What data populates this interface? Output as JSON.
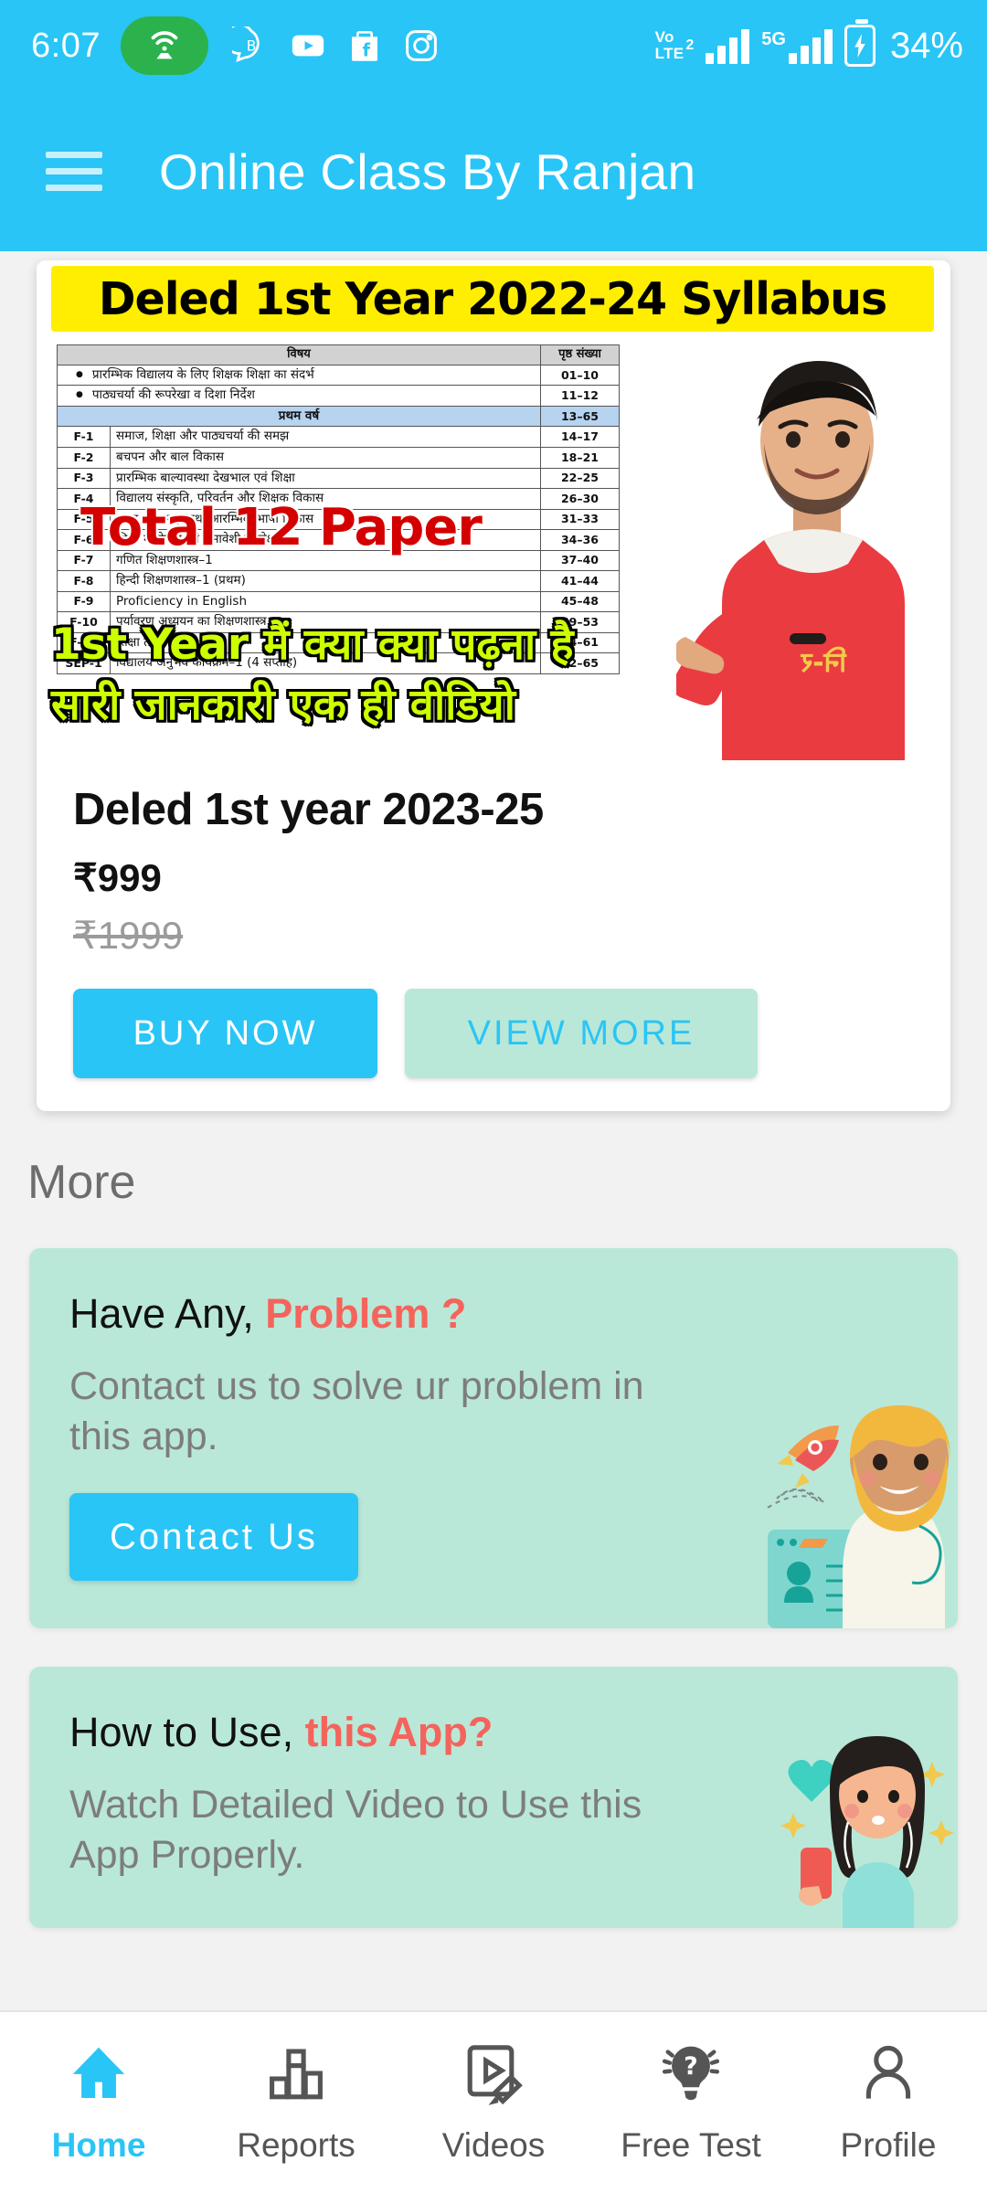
{
  "statusbar": {
    "time": "6:07",
    "hotspot_icon": "hotspot-icon",
    "notif_icons": [
      "bluestacks-icon",
      "youtube-icon",
      "flipkart-icon",
      "instagram-icon"
    ],
    "volte_label_top": "Vo",
    "volte_label_bottom": "LTE",
    "sim_badge": "2",
    "network_label": "5G",
    "battery_percent": "34%"
  },
  "appbar": {
    "menu_icon": "hamburger-menu-icon",
    "title": "Online Class By Ranjan"
  },
  "course": {
    "thumbnail": {
      "banner_text": "Deled 1st Year 2022-24 Syllabus",
      "overlay_red": "Total 12 Paper",
      "overlay_hindi_line1": "1st Year मैं क्या क्या पढ़ना है",
      "overlay_hindi_line2": "सारी जानकारी एक ही वीडियो",
      "syllabus_table": {
        "headers": [
          "विषय",
          "पृष्ठ संख्या"
        ],
        "rows": [
          {
            "code": "",
            "subject": "प्रारम्भिक विद्यालय के लिए शिक्षक शिक्षा का संदर्भ",
            "pages": "01–10",
            "bullet": true
          },
          {
            "code": "",
            "subject": "पाठ्यचर्या की रूपरेखा व दिशा निर्देश",
            "pages": "11–12",
            "bullet": true
          },
          {
            "code": "",
            "subject": "प्रथम वर्ष",
            "pages": "13–65",
            "highlight": true
          },
          {
            "code": "F-1",
            "subject": "समाज, शिक्षा और पाठ्यचर्या की समझ",
            "pages": "14–17"
          },
          {
            "code": "F-2",
            "subject": "बचपन और बाल विकास",
            "pages": "18–21"
          },
          {
            "code": "F-3",
            "subject": "प्रारम्भिक बाल्यावस्था देखभाल एवं शिक्षा",
            "pages": "22–25"
          },
          {
            "code": "F-4",
            "subject": "विद्यालय संस्कृति, परिवर्तन और शिक्षक विकास",
            "pages": "26–30"
          },
          {
            "code": "F-5",
            "subject": "भाषा की समझ तथा आरम्भिक भाषा विकास",
            "pages": "31–33"
          },
          {
            "code": "F-6",
            "subject": "शिक्षा में जेण्डर एवं समावेशी परिप्रेक्ष्य",
            "pages": "34–36"
          },
          {
            "code": "F-7",
            "subject": "गणित शिक्षणशास्त्र–1",
            "pages": "37–40"
          },
          {
            "code": "F-8",
            "subject": "हिन्दी शिक्षणशास्त्र–1 (प्रथम)",
            "pages": "41–44"
          },
          {
            "code": "F-9",
            "subject": "Proficiency in English",
            "pages": "45–48"
          },
          {
            "code": "F-10",
            "subject": "पर्यावरण अध्ययन का शिक्षणशास्त्र",
            "pages": "49–53"
          },
          {
            "code": "F-11",
            "subject": "शिक्षा तकनीकी",
            "pages": "54–61"
          },
          {
            "code": "SEP-1",
            "subject": "विद्यालय अनुभव कार्यक्रम–1 (4 सप्ताह)",
            "pages": "62–65"
          }
        ]
      }
    },
    "title": "Deled 1st year 2023-25",
    "price": "₹999",
    "price_original": "₹1999",
    "buy_label": "BUY NOW",
    "view_label": "VIEW MORE"
  },
  "more": {
    "heading": "More",
    "cards": [
      {
        "title_plain": "Have Any, ",
        "title_accent": "Problem ?",
        "subtitle": "Contact us to solve ur problem in this app.",
        "button_label": "Contact Us",
        "art": "support-agent-illustration"
      },
      {
        "title_plain": "How to Use, ",
        "title_accent": "this App?",
        "subtitle": "Watch Detailed Video to Use this App Properly.",
        "art": "girl-with-phone-illustration"
      }
    ]
  },
  "bottomnav": {
    "items": [
      {
        "label": "Home",
        "icon": "home-icon",
        "active": true
      },
      {
        "label": "Reports",
        "icon": "bar-chart-icon",
        "active": false
      },
      {
        "label": "Videos",
        "icon": "video-edit-icon",
        "active": false
      },
      {
        "label": "Free Test",
        "icon": "lightbulb-question-icon",
        "active": false
      },
      {
        "label": "Profile",
        "icon": "person-icon",
        "active": false
      }
    ]
  },
  "colors": {
    "primary": "#29c5f6",
    "card_mint": "#b9e8d8",
    "accent_red": "#f4645c",
    "banner_yellow": "#ffee00",
    "overlay_yellow": "#ccff00",
    "overlay_red": "#d40000"
  }
}
